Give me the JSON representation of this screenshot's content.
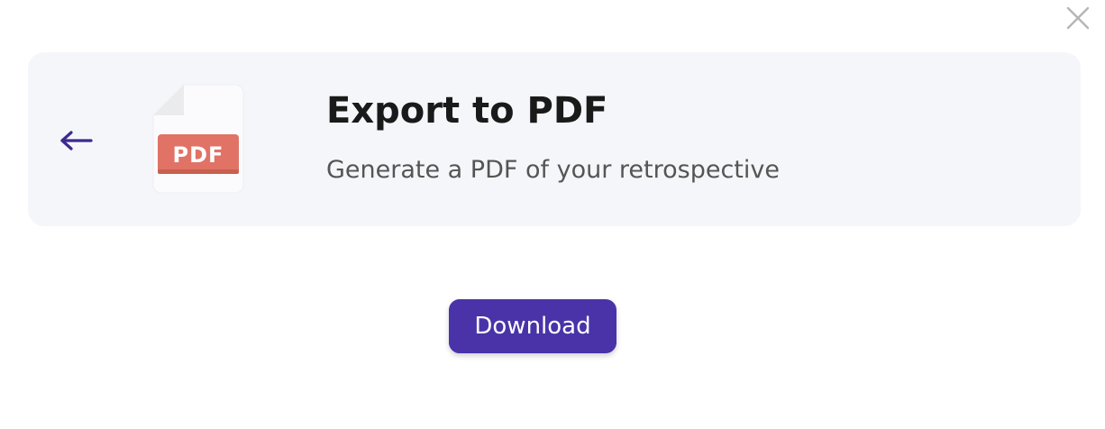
{
  "dialog": {
    "close_icon": "close-icon",
    "back_icon": "arrow-left-icon",
    "file_icon": "pdf-file-icon",
    "file_icon_label": "PDF",
    "title": "Export to PDF",
    "subtitle": "Generate a PDF of your retrospective",
    "download_label": "Download"
  },
  "colors": {
    "accent": "#4a33a8",
    "back_arrow": "#3d2a8f",
    "pdf_badge": "#e07366",
    "card_background": "#f5f6fa",
    "close_icon": "#b5b5b5"
  }
}
